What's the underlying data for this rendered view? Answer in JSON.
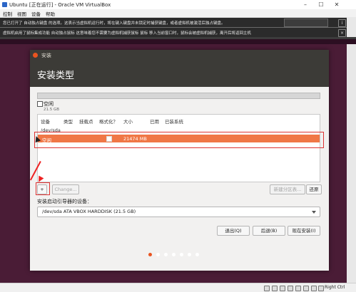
{
  "window": {
    "title": "Ubuntu [正在运行] - Oracle VM VirtualBox",
    "minimize": "–",
    "maximize": "☐",
    "close": "✕"
  },
  "menubar": {
    "items": [
      "控制",
      "视图",
      "设备",
      "帮助"
    ]
  },
  "notices": [
    {
      "text": "您已打开了 自动独占键盘 的选项。这表示当虚拟机运行时，将在键入键盘并未锁定时捕获键盘，或者虚拟机被激活后独占键盘。"
    },
    {
      "text": "虚拟机启用了鼠标集成功能 自动独占鼠标 这意味着您不需要为虚拟机捕获鼠标 鼠标 移入当前窗口时，鼠标会被虚拟机捕获，离开后将返回主机"
    }
  ],
  "dialog": {
    "title": "安装",
    "header": "安装类型",
    "free_label": "空闲",
    "free_size": "21.5 GB",
    "table": {
      "headers": [
        "设备",
        "类型",
        "挂载点",
        "格式化？",
        "大小",
        "已用",
        "已装系统"
      ],
      "device": "/dev/sda",
      "selected_row": {
        "device": "空闲",
        "size": "21474 MB"
      }
    },
    "buttons": {
      "add": "+",
      "change": "Change...",
      "new_table": "新建分区表...",
      "revert": "还原",
      "quit": "退出(Q)",
      "back": "后退(B)",
      "install_now": "现在安装(I)"
    },
    "boot_loader_label": "安装启动引导器的设备：",
    "boot_loader_value": "/dev/sda  ATA VBOX HARDDISK (21.5 GB)"
  },
  "progress_dots": {
    "count": 7,
    "active_index": 0,
    "active_color": "#e95420"
  },
  "statusbar": {
    "host_key": "Right Ctrl"
  },
  "colors": {
    "accent": "#e95420",
    "selected_row": "#f07746",
    "annotation": "#dd3333",
    "dialog_header": "#3c3b37"
  }
}
